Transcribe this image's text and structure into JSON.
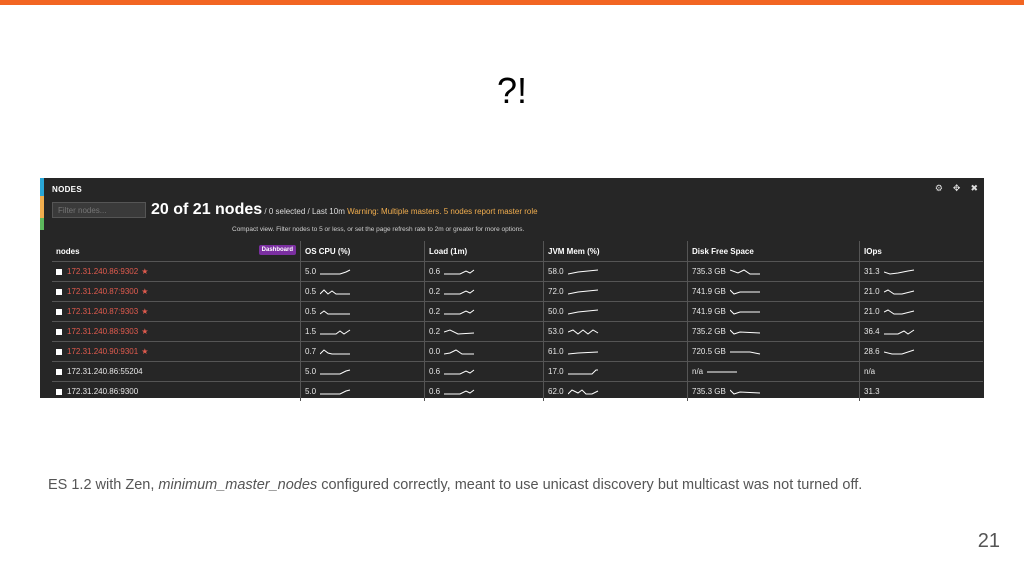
{
  "slide": {
    "title": "?!",
    "caption_pre": "ES 1.2 with Zen, ",
    "caption_em": "minimum_master_nodes",
    "caption_post": " configured correctly, meant to use unicast discovery but multicast was not turned off.",
    "number": "21",
    "accent_color": "#f26522"
  },
  "panel": {
    "header": "NODES",
    "icons": [
      "gear-icon",
      "move-icon",
      "close-icon"
    ],
    "filter_placeholder": "Filter nodes...",
    "count": "20 of 21 nodes",
    "count_rest": " / 0 selected / Last 10m ",
    "warning": "Warning: Multiple masters. 5 nodes report master role",
    "compact_note": "Compact view. Filter nodes to 5 or less, or set the page refresh rate to 2m or greater for more options.",
    "dashboard_label": "Dashboard",
    "stripe_colors": [
      "#2aa6d6",
      "#f0ad4e",
      "#5cb85c"
    ]
  },
  "table": {
    "columns": [
      "nodes",
      "OS CPU (%)",
      "Load (1m)",
      "JVM Mem (%)",
      "Disk Free Space",
      "IOps"
    ],
    "rows": [
      {
        "host": "172.31.240.86:9302",
        "master": true,
        "cpu": "5.0",
        "load": "0.6",
        "jvm": "58.0",
        "disk": "735.3 GB",
        "iops": "31.3"
      },
      {
        "host": "172.31.240.87:9300",
        "master": true,
        "cpu": "0.5",
        "load": "0.2",
        "jvm": "72.0",
        "disk": "741.9 GB",
        "iops": "21.0"
      },
      {
        "host": "172.31.240.87:9303",
        "master": true,
        "cpu": "0.5",
        "load": "0.2",
        "jvm": "50.0",
        "disk": "741.9 GB",
        "iops": "21.0"
      },
      {
        "host": "172.31.240.88:9303",
        "master": true,
        "cpu": "1.5",
        "load": "0.2",
        "jvm": "53.0",
        "disk": "735.2 GB",
        "iops": "36.4"
      },
      {
        "host": "172.31.240.90:9301",
        "master": true,
        "cpu": "0.7",
        "load": "0.0",
        "jvm": "61.0",
        "disk": "720.5 GB",
        "iops": "28.6"
      },
      {
        "host": "172.31.240.86:55204",
        "master": false,
        "cpu": "5.0",
        "load": "0.6",
        "jvm": "17.0",
        "disk": "n/a",
        "iops": "n/a"
      },
      {
        "host": "172.31.240.86:9300",
        "master": false,
        "cpu": "5.0",
        "load": "0.6",
        "jvm": "62.0",
        "disk": "735.3 GB",
        "iops": "31.3"
      }
    ]
  }
}
